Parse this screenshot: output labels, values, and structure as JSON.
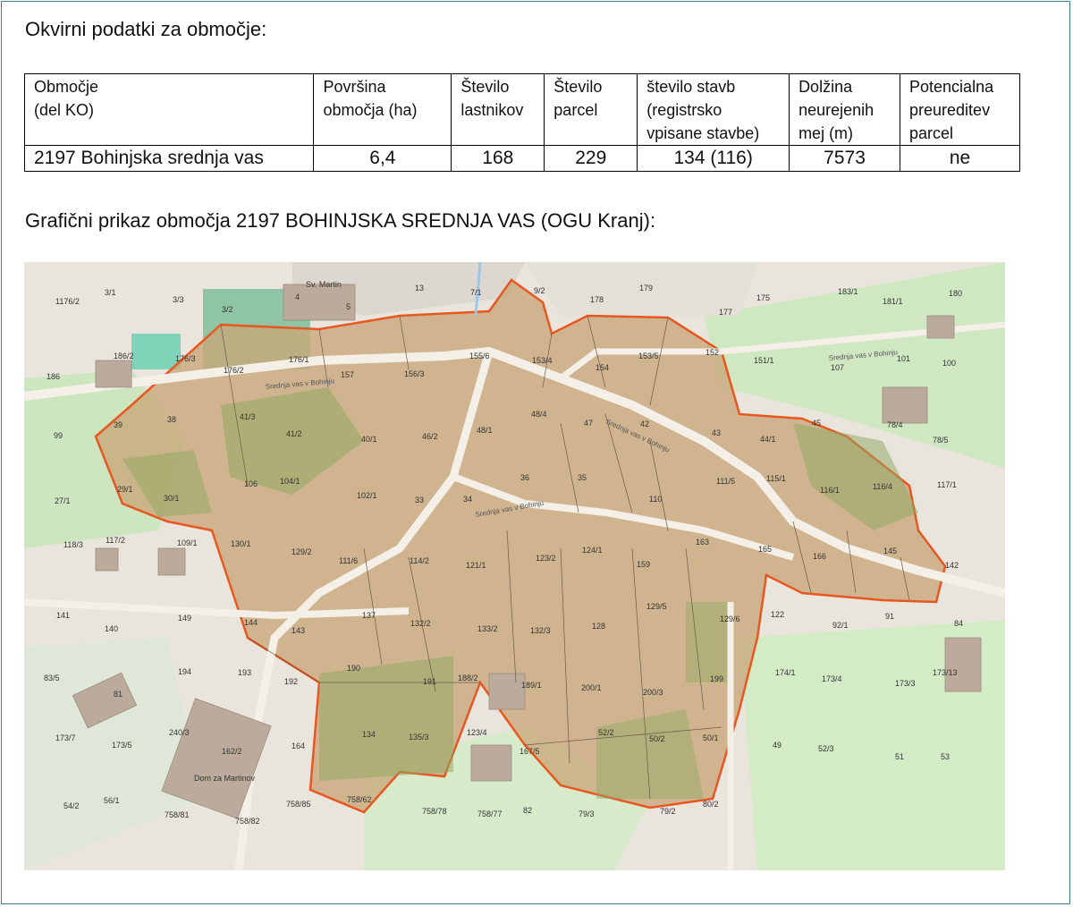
{
  "section_title": "Okvirni podatki za območje:",
  "table": {
    "headers": [
      "Območje\n(del KO)",
      "Površina\nobmočja (ha)",
      "Število\nlastnikov",
      "Število\nparcel",
      "število stavb\n(registrsko\nvpisane stavbe)",
      "Dolžina\nneurejenih\nmej (m)",
      "Potencialna\npreureditev\nparcel"
    ],
    "row": [
      "2197 Bohinjska srednja vas",
      "6,4",
      "168",
      "229",
      "134 (116)",
      "7573",
      "ne"
    ]
  },
  "map_title": "Grafični prikaz območja 2197 BOHINJSKA SREDNJA VAS (OGU Kranj):",
  "map": {
    "boundary_color": "#e8571f",
    "area_fill": "#c9a77a",
    "street_labels": [
      "Srednja vas v Bohinju",
      "Srednja vas v Bohinju",
      "Srednja vas v Bohinju",
      "Srednja vas v Bohinju"
    ],
    "poi_labels": [
      "Sv. Martin",
      "Dom za Martinov"
    ],
    "parcel_labels": [
      "1176/2",
      "3/1",
      "3/3",
      "3/2",
      "4",
      "5",
      "13",
      "7/1",
      "9/2",
      "178",
      "179",
      "177",
      "175",
      "183/1",
      "181/1",
      "180",
      "186",
      "186/2",
      "176/3",
      "176/2",
      "176/1",
      "157",
      "156/3",
      "155/6",
      "153/4",
      "154",
      "153/5",
      "152",
      "151/1",
      "107",
      "101",
      "100",
      "99",
      "39",
      "38",
      "41/3",
      "41/2",
      "40/1",
      "46/2",
      "48/1",
      "48/4",
      "47",
      "42",
      "43",
      "44/1",
      "45",
      "78/4",
      "78/5",
      "27/1",
      "29/1",
      "30/1",
      "106",
      "104/1",
      "102/1",
      "33",
      "34",
      "36",
      "35",
      "110",
      "111/5",
      "115/1",
      "116/1",
      "116/4",
      "117/1",
      "118/3",
      "117/2",
      "109/1",
      "130/1",
      "129/2",
      "111/6",
      "114/2",
      "121/1",
      "123/2",
      "124/1",
      "159",
      "163",
      "165",
      "166",
      "145",
      "142",
      "141",
      "140",
      "149",
      "144",
      "143",
      "137",
      "132/2",
      "133/2",
      "132/3",
      "128",
      "129/5",
      "129/6",
      "122",
      "92/1",
      "91",
      "84",
      "83/5",
      "81",
      "194",
      "193",
      "192",
      "190",
      "191",
      "188/2",
      "189/1",
      "200/1",
      "200/3",
      "199",
      "174/1",
      "173/4",
      "173/3",
      "173/13",
      "173/7",
      "173/5",
      "240/3",
      "162/2",
      "164",
      "134",
      "135/3",
      "123/4",
      "167/5",
      "52/2",
      "50/2",
      "50/1",
      "49",
      "52/3",
      "51",
      "53",
      "54/2",
      "56/1",
      "758/81",
      "758/82",
      "758/85",
      "758/62",
      "758/78",
      "758/77",
      "82",
      "79/3",
      "79/2",
      "80/2"
    ]
  }
}
